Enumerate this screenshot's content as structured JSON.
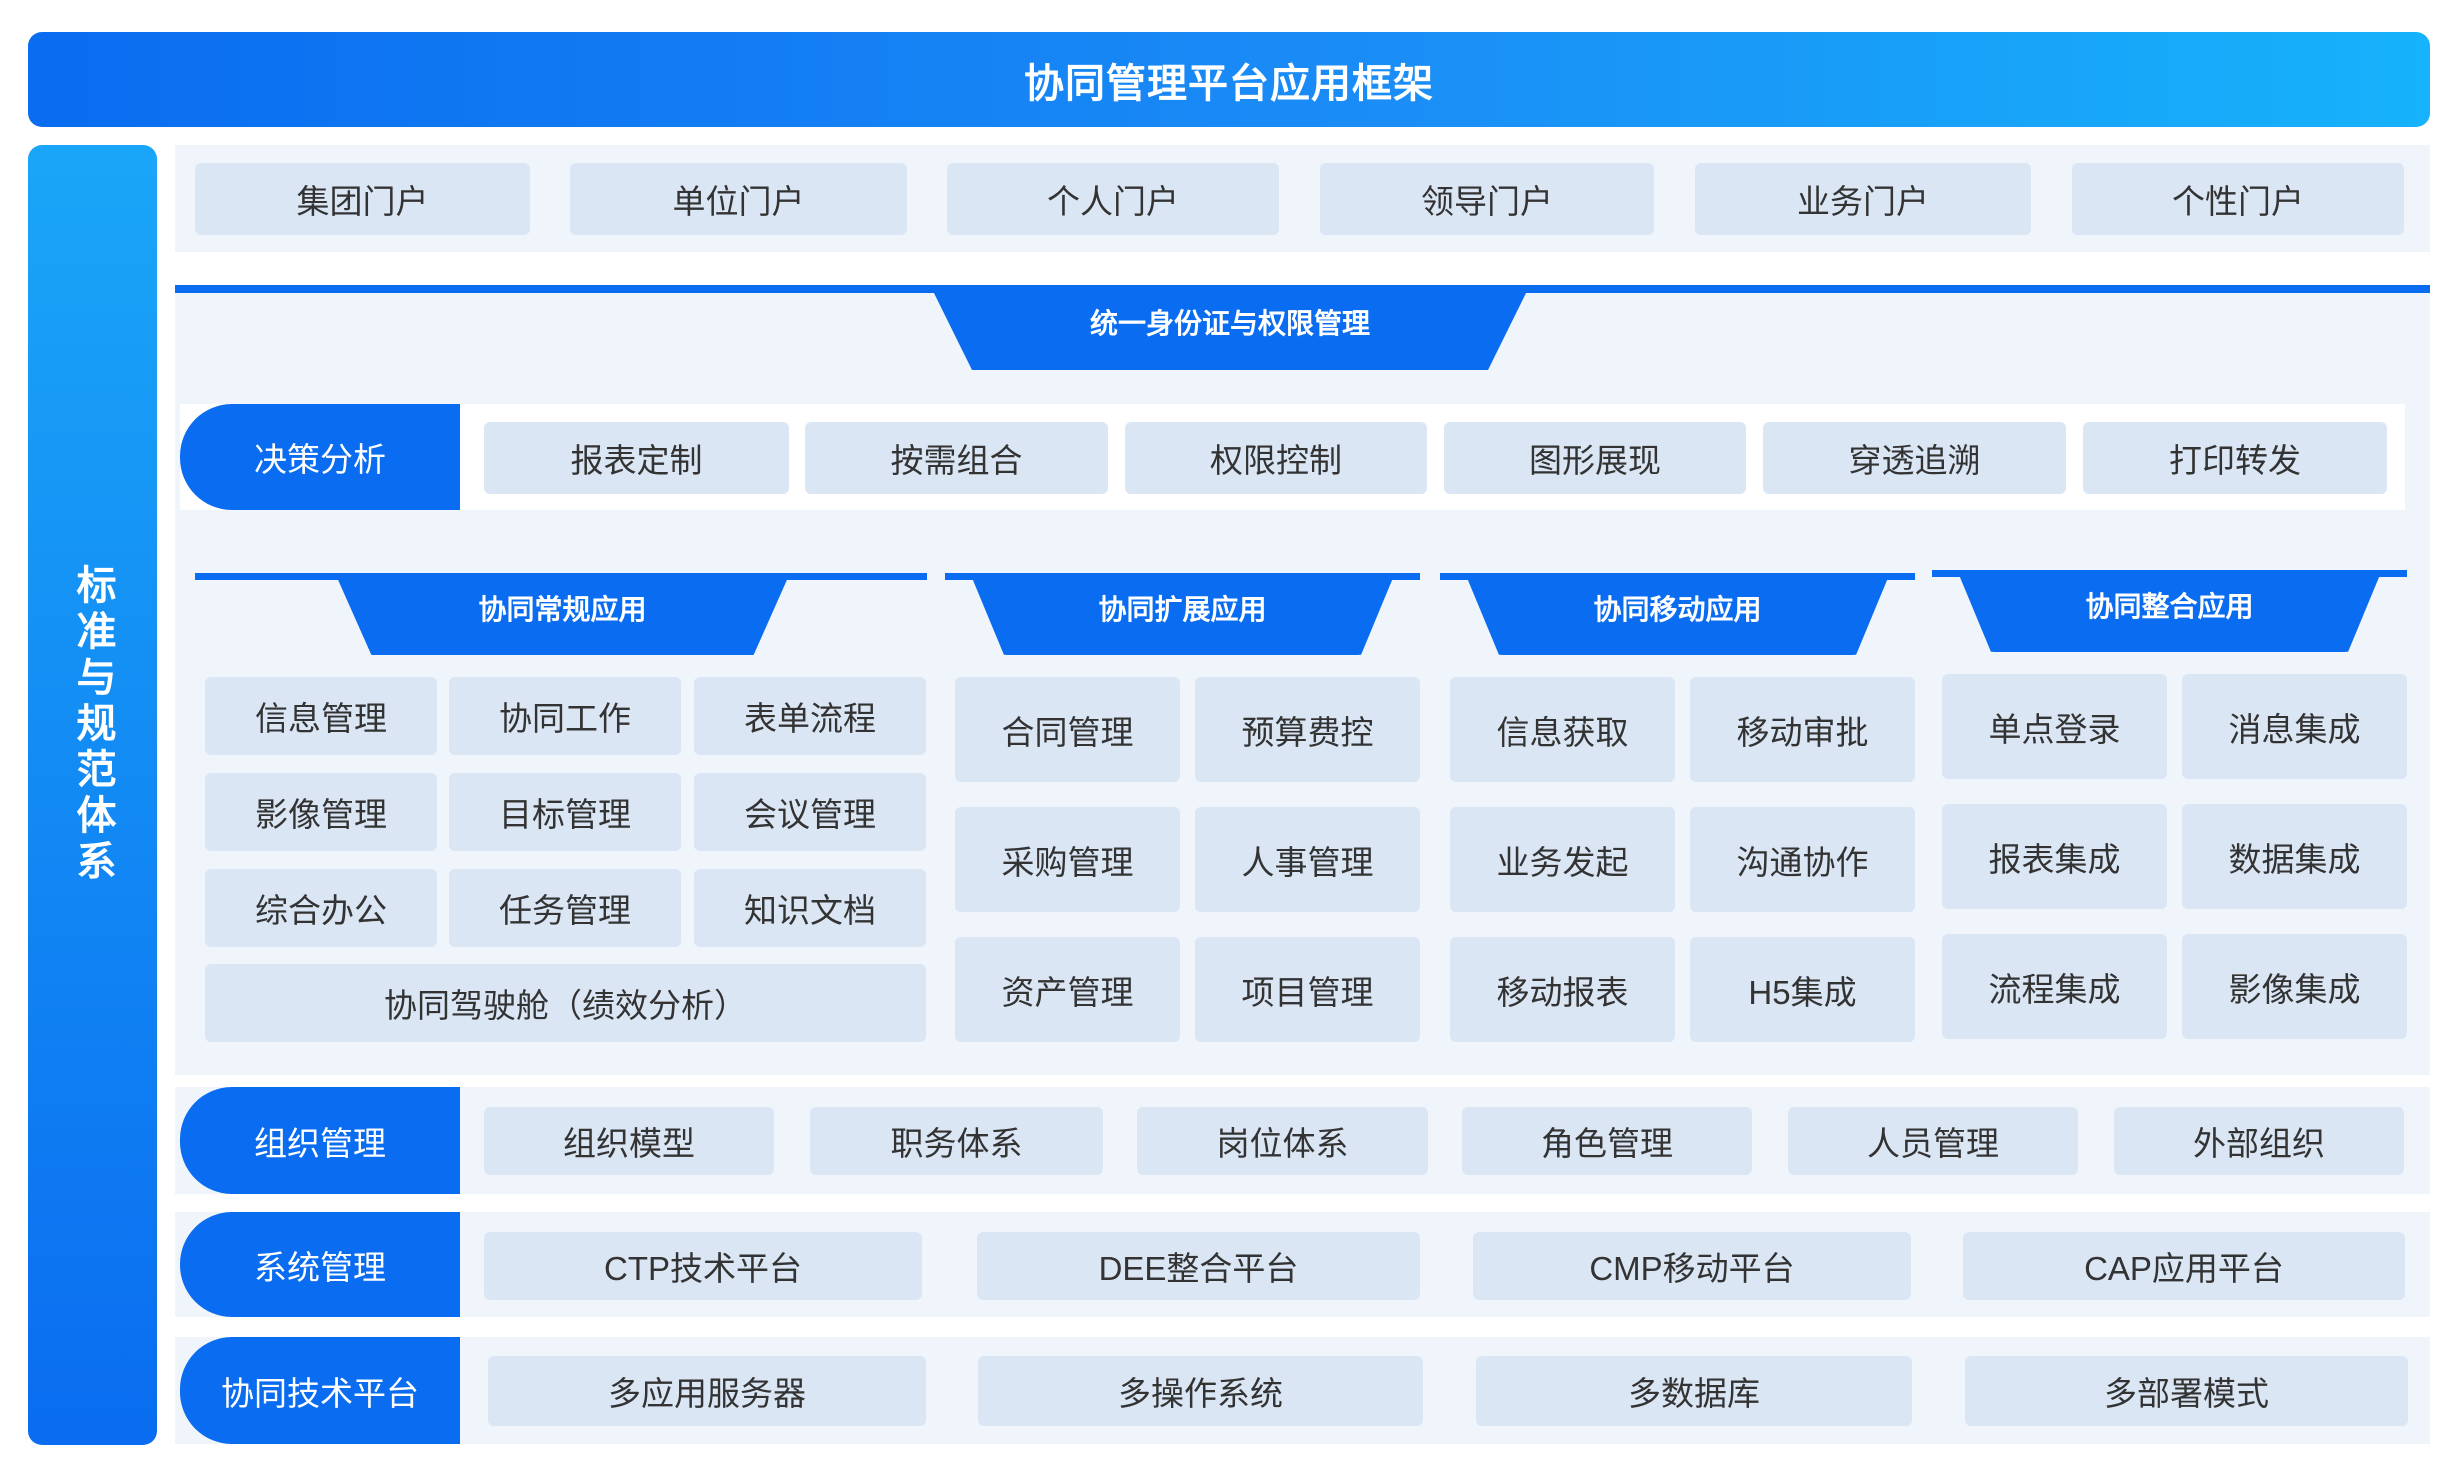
{
  "title": "协同管理平台应用框架",
  "side_title": "标准与规范体系",
  "portals": [
    "集团门户",
    "单位门户",
    "个人门户",
    "领导门户",
    "业务门户",
    "个性门户"
  ],
  "identity": "统一身份证与权限管理",
  "decision": {
    "label": "决策分析",
    "items": [
      "报表定制",
      "按需组合",
      "权限控制",
      "图形展现",
      "穿透追溯",
      "打印转发"
    ]
  },
  "apps": {
    "regular": {
      "title": "协同常规应用",
      "items": [
        "信息管理",
        "协同工作",
        "表单流程",
        "影像管理",
        "目标管理",
        "会议管理",
        "综合办公",
        "任务管理",
        "知识文档"
      ],
      "wide_item": "协同驾驶舱（绩效分析）"
    },
    "extended": {
      "title": "协同扩展应用",
      "items": [
        "合同管理",
        "预算费控",
        "采购管理",
        "人事管理",
        "资产管理",
        "项目管理"
      ]
    },
    "mobile": {
      "title": "协同移动应用",
      "items": [
        "信息获取",
        "移动审批",
        "业务发起",
        "沟通协作",
        "移动报表",
        "H5集成"
      ]
    },
    "integration": {
      "title": "协同整合应用",
      "items": [
        "单点登录",
        "消息集成",
        "报表集成",
        "数据集成",
        "流程集成",
        "影像集成"
      ]
    }
  },
  "org": {
    "label": "组织管理",
    "items": [
      "组织模型",
      "职务体系",
      "岗位体系",
      "角色管理",
      "人员管理",
      "外部组织"
    ]
  },
  "system": {
    "label": "系统管理",
    "items": [
      "CTP技术平台",
      "DEE整合平台",
      "CMP移动平台",
      "CAP应用平台"
    ]
  },
  "tech": {
    "label": "协同技术平台",
    "items": [
      "多应用服务器",
      "多操作系统",
      "多数据库",
      "多部署模式"
    ]
  },
  "colors": {
    "primary": "#0a6cf0",
    "accent": "#16b2fb",
    "box": "#dbe6f5",
    "panel": "#f0f5fc"
  }
}
